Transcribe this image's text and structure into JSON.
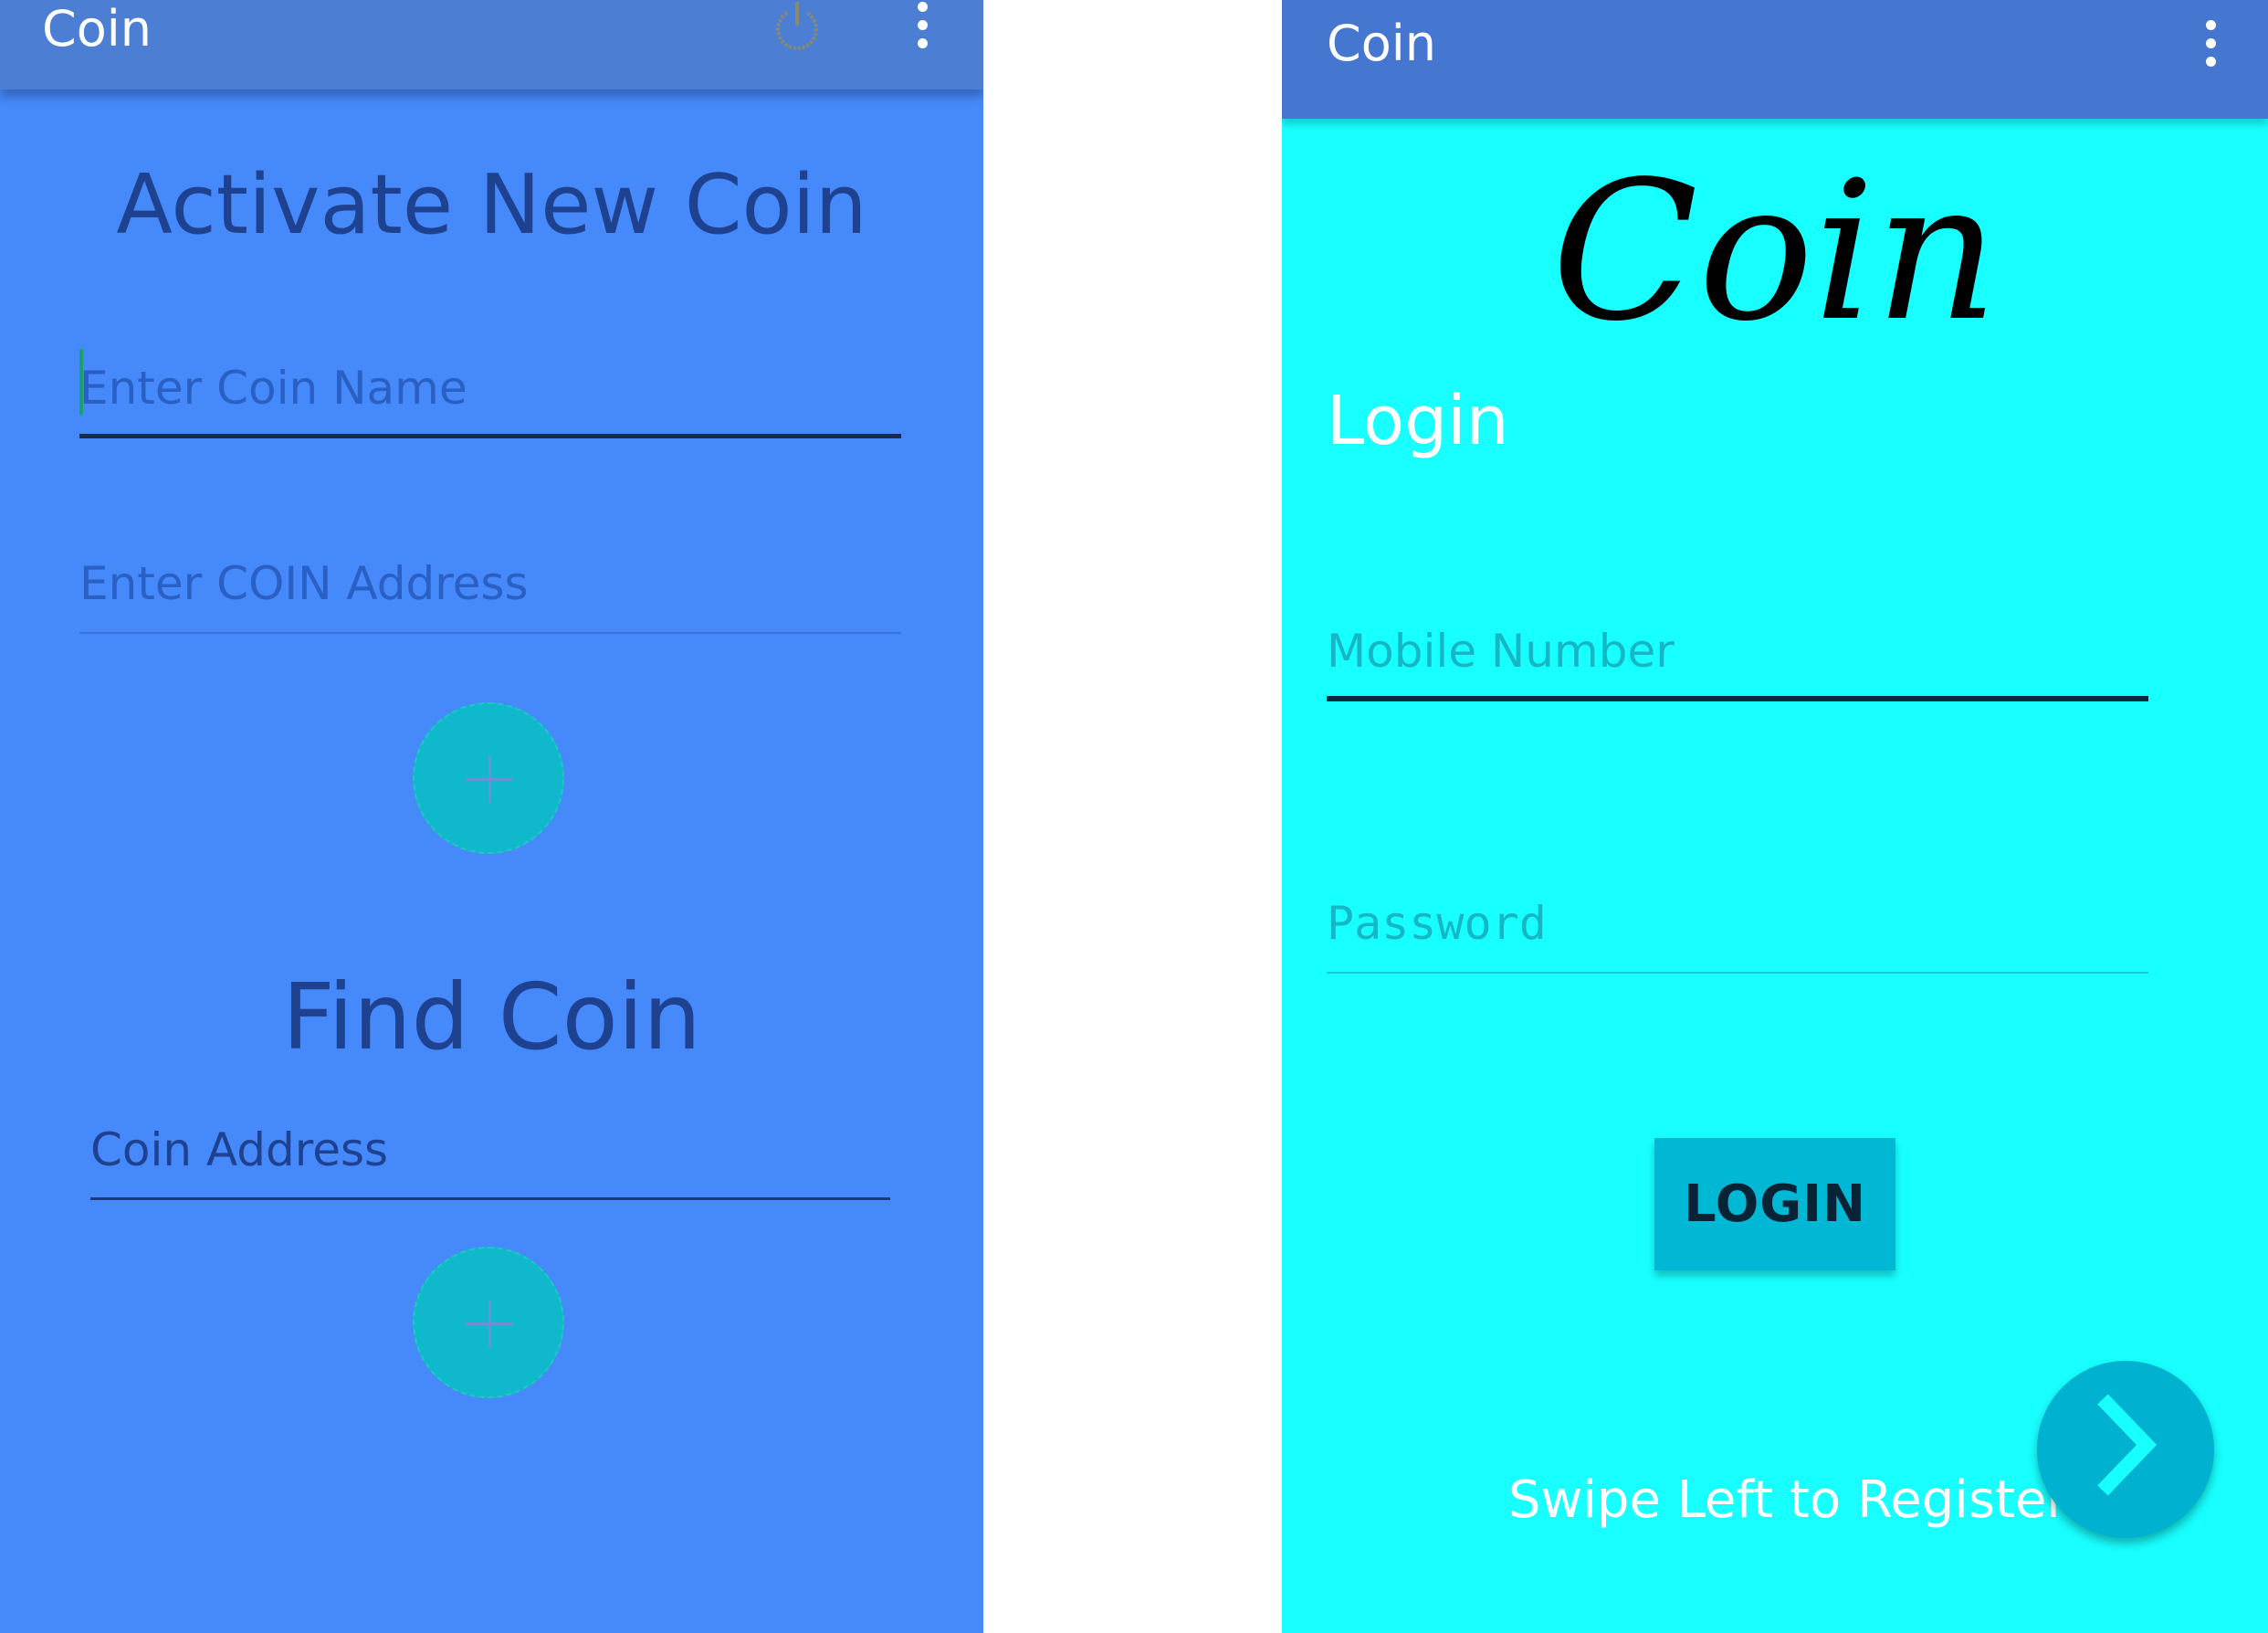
{
  "left_screen": {
    "app_title": "Coin",
    "activate_heading": "Activate New Coin",
    "coin_name_placeholder": "Enter Coin Name",
    "coin_address_placeholder": "Enter COIN Address",
    "find_heading": "Find Coin",
    "find_address_placeholder": "Coin Address",
    "icons": [
      "power-icon",
      "overflow-menu-icon",
      "plus-icon"
    ]
  },
  "right_screen": {
    "app_title": "Coin",
    "logo_text": "Coin",
    "login_heading": "Login",
    "mobile_placeholder": "Mobile Number",
    "password_placeholder": "Password",
    "login_button": "LOGIN",
    "swipe_hint": "Swipe Left to Register",
    "icons": [
      "overflow-menu-icon",
      "chevron-right-icon"
    ]
  },
  "colors": {
    "left_background": "#4589fb",
    "left_appbar": "#4c7fd3",
    "right_background": "#18ffff",
    "right_appbar": "#4677d0",
    "fab": "#00b8d4"
  }
}
